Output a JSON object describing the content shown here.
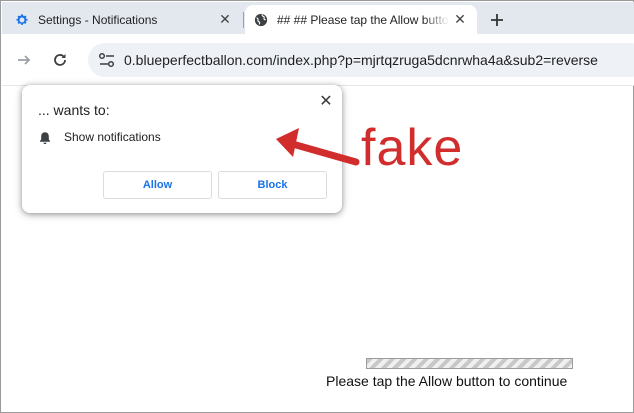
{
  "tabs": [
    {
      "title": "Settings - Notifications",
      "icon": "gear-icon",
      "active": false
    },
    {
      "title": "## ## Please tap the Allow button to continue",
      "icon": "globe-icon",
      "active": true
    }
  ],
  "toolbar": {
    "url": "0.blueperfectballon.com/index.php?p=mjrtqzruga5dcnrwha4a&sub2=reverse"
  },
  "permission_prompt": {
    "title": "... wants to:",
    "permission": "Show notifications",
    "allow_label": "Allow",
    "block_label": "Block"
  },
  "annotation": {
    "label": "fake",
    "color": "#d12d2d"
  },
  "page": {
    "continue_text": "Please tap the Allow button to continue"
  },
  "colors": {
    "tabstrip": "#e3e8ef",
    "button_text": "#1a73e8",
    "tab_gear_icon": "#1a73e8"
  }
}
